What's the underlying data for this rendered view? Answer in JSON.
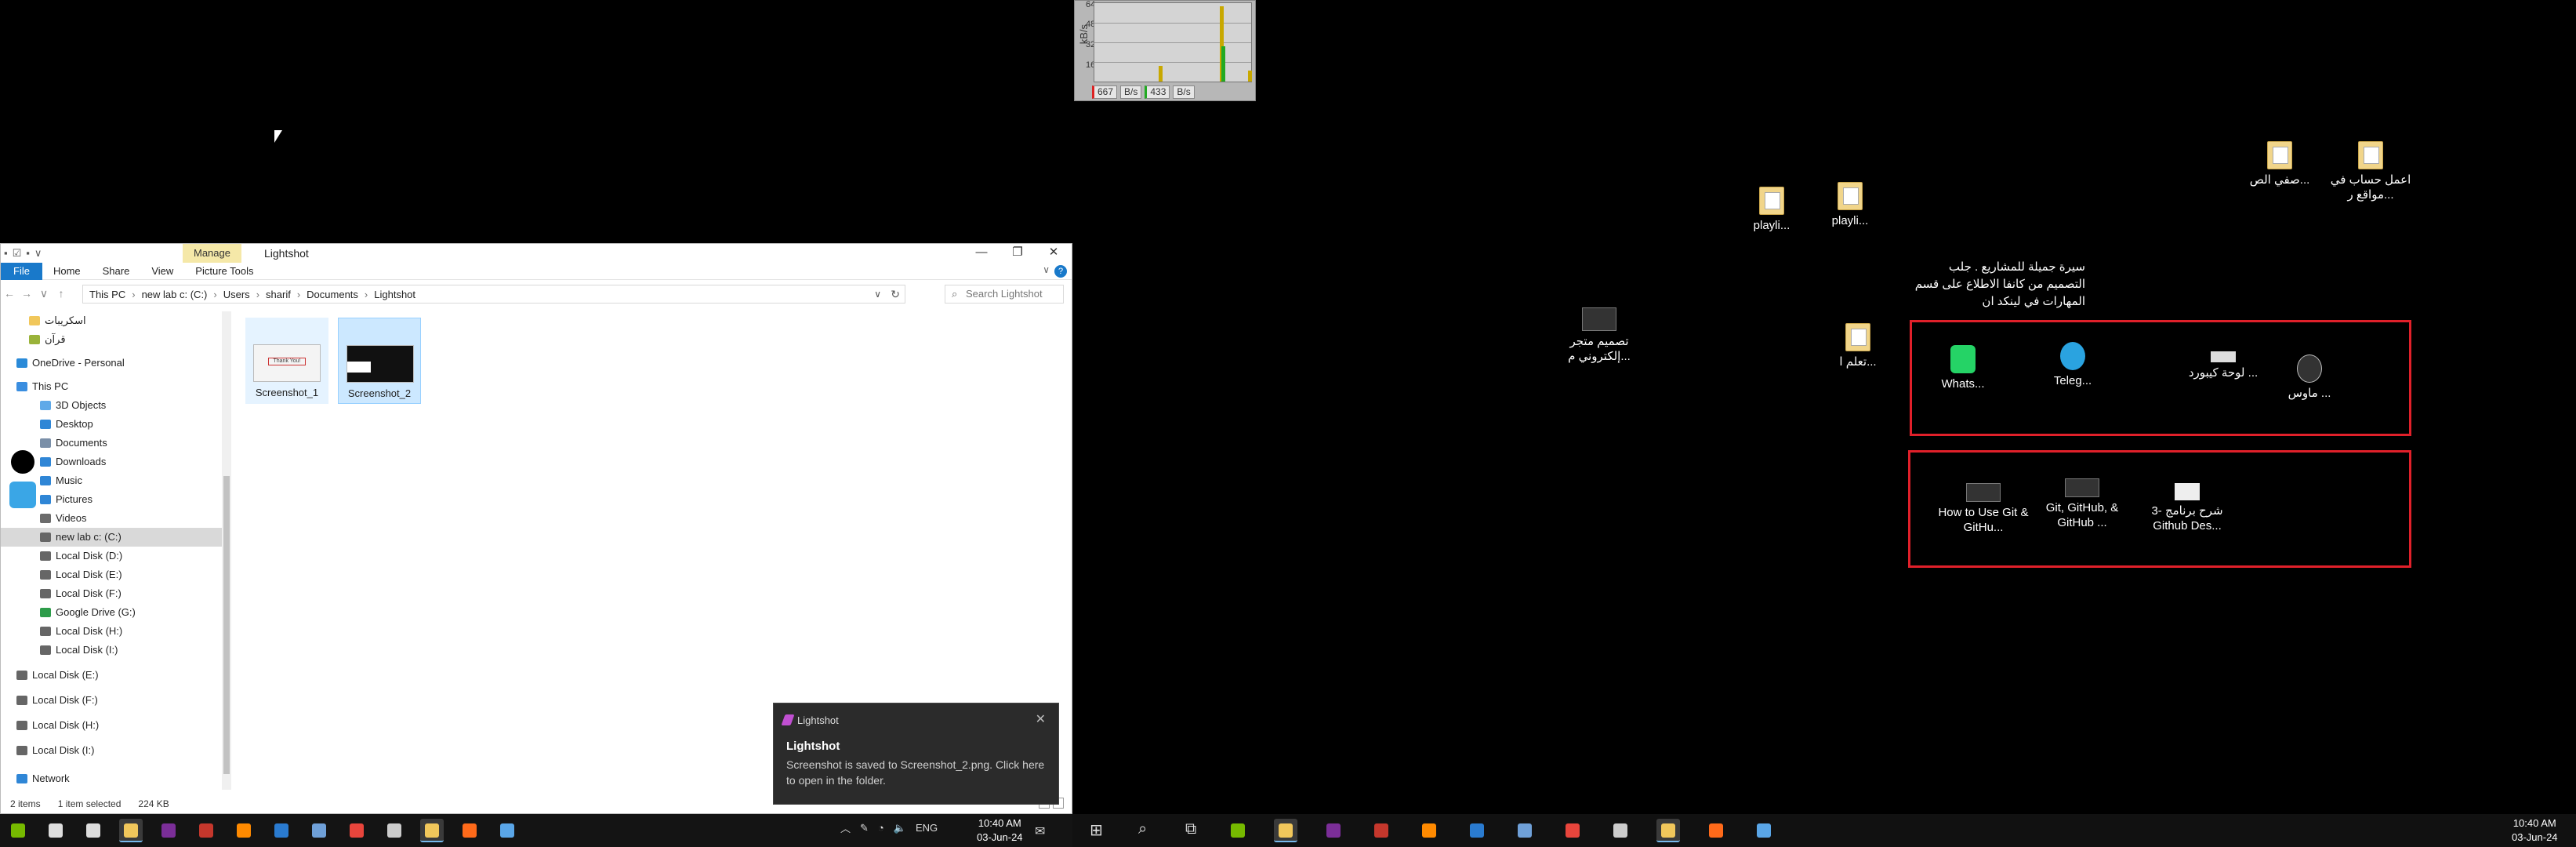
{
  "netmeter": {
    "unit": "kB/s",
    "ticks": [
      "64",
      "48",
      "32",
      "16"
    ],
    "download_value": "667",
    "download_unit": "B/s",
    "upload_value": "433",
    "upload_unit": "B/s",
    "colors": {
      "download": "#d22222",
      "upload": "#22aa22",
      "accent": "#c8a800"
    }
  },
  "desktop": {
    "icons": [
      {
        "id": "d1",
        "label": "اعمل حساب في مواقع ر...",
        "icon": "folder-file-icon"
      },
      {
        "id": "d2",
        "label": "صفي الص...",
        "icon": "folder-file-icon"
      },
      {
        "id": "d3",
        "label": "playli...",
        "icon": "file-icon"
      },
      {
        "id": "d4",
        "label": "playli...",
        "icon": "file-icon"
      },
      {
        "id": "d5",
        "label": "تصميم متجر إلكتروني م...",
        "icon": "image-thumbnail-icon"
      },
      {
        "id": "d6",
        "label": "تعلم ا...",
        "icon": "file-icon"
      },
      {
        "id": "d7",
        "label": "Whats...",
        "icon": "whatsapp-icon"
      },
      {
        "id": "d8",
        "label": "Teleg...",
        "icon": "telegram-icon"
      },
      {
        "id": "d9",
        "label": "لوحة كيبورد ...",
        "icon": "keyboard-icon"
      },
      {
        "id": "d10",
        "label": "ماوس ...",
        "icon": "mouse-icon"
      },
      {
        "id": "d11",
        "label": "How to Use Git & GitHu...",
        "icon": "video-thumbnail-icon"
      },
      {
        "id": "d12",
        "label": "Git, GitHub, & GitHub ...",
        "icon": "video-thumbnail-icon"
      },
      {
        "id": "d13",
        "label": "3- شرح برنامج Github Des...",
        "icon": "video-thumbnail-icon"
      }
    ],
    "note": "سيرة جميلة للمشاريع . جلب التصميم من كانفا الاطلاع على قسم المهارات في لينكد ان"
  },
  "explorer": {
    "qat": [
      "▪",
      "☑",
      "▪",
      "∨"
    ],
    "manage_tab": "Manage",
    "title": "Lightshot",
    "window_controls": [
      "—",
      "❐",
      "✕"
    ],
    "ribbon_tabs": [
      "File",
      "Home",
      "Share",
      "View",
      "Picture Tools"
    ],
    "help": "?",
    "chevron": "∨",
    "nav_buttons": [
      "←",
      "→",
      "∨",
      "↑"
    ],
    "breadcrumb": [
      "This PC",
      "new lab c: (C:)",
      "Users",
      "sharif",
      "Documents",
      "Lightshot"
    ],
    "breadcrumb_sep": "›",
    "address_dropdown": "∨",
    "refresh": "↻",
    "search_placeholder": "Search Lightshot",
    "search_glyph": "⌕",
    "nav_items": [
      {
        "label": "اسكريبات",
        "icon": "folder-icon",
        "color": "#f1c75b"
      },
      {
        "label": "قرآن",
        "icon": "folder-icon",
        "color": "#9ab33a"
      },
      {
        "label": "OneDrive - Personal",
        "icon": "onedrive-icon",
        "color": "#2a8ad8"
      },
      {
        "label": "This PC",
        "icon": "pc-icon",
        "color": "#3a8ee0"
      },
      {
        "label": "3D Objects",
        "icon": "3d-objects-icon",
        "color": "#5fa9e8"
      },
      {
        "label": "Desktop",
        "icon": "desktop-folder-icon",
        "color": "#2f86d6"
      },
      {
        "label": "Documents",
        "icon": "documents-icon",
        "color": "#7a8fa8"
      },
      {
        "label": "Downloads",
        "icon": "downloads-icon",
        "color": "#2f86d6"
      },
      {
        "label": "Music",
        "icon": "music-icon",
        "color": "#2f86d6"
      },
      {
        "label": "Pictures",
        "icon": "pictures-icon",
        "color": "#2f86d6"
      },
      {
        "label": "Videos",
        "icon": "videos-icon",
        "color": "#6b6b6b"
      },
      {
        "label": "new lab c: (C:)",
        "icon": "drive-icon",
        "color": "#666666"
      },
      {
        "label": "Local Disk (D:)",
        "icon": "drive-icon",
        "color": "#666666"
      },
      {
        "label": "Local Disk (E:)",
        "icon": "drive-icon",
        "color": "#666666"
      },
      {
        "label": "Local Disk (F:)",
        "icon": "drive-icon",
        "color": "#666666"
      },
      {
        "label": "Google Drive (G:)",
        "icon": "google-drive-icon",
        "color": "#2d9c4a"
      },
      {
        "label": "Local Disk (H:)",
        "icon": "drive-icon",
        "color": "#666666"
      },
      {
        "label": "Local Disk (I:)",
        "icon": "drive-icon",
        "color": "#666666"
      },
      {
        "label": "Local Disk (E:)",
        "icon": "drive-icon",
        "color": "#666666"
      },
      {
        "label": "Local Disk (F:)",
        "icon": "drive-icon",
        "color": "#666666"
      },
      {
        "label": "Local Disk (H:)",
        "icon": "drive-icon",
        "color": "#666666"
      },
      {
        "label": "Local Disk (I:)",
        "icon": "drive-icon",
        "color": "#666666"
      },
      {
        "label": "Network",
        "icon": "network-icon",
        "color": "#2f86d6"
      }
    ],
    "selected_nav": "new lab c: (C:)",
    "files": [
      {
        "name": "Screenshot_1",
        "state": "hover",
        "thumb_label": "Thank You!"
      },
      {
        "name": "Screenshot_2",
        "state": "selected"
      }
    ],
    "status": {
      "items": "2 items",
      "selection": "1 item selected",
      "size": "224 KB"
    }
  },
  "toast": {
    "app_name": "Lightshot",
    "close": "✕",
    "title": "Lightshot",
    "body": "Screenshot is saved to Screenshot_2.png. Click here to open in the folder."
  },
  "taskbar_left": {
    "tray_chevron": "︿",
    "lang": "ENG",
    "time": "10:40 AM",
    "date": "03-Jun-24",
    "notify_glyph": "✉",
    "apps": [
      {
        "name": "nvidia-icon",
        "color": "#76b900"
      },
      {
        "name": "search-icon",
        "color": "#dddddd"
      },
      {
        "name": "task-view-icon",
        "color": "#dddddd"
      },
      {
        "name": "file-explorer-icon",
        "color": "#f1c75b",
        "active": true
      },
      {
        "name": "onenote-icon",
        "color": "#7b2e98"
      },
      {
        "name": "app-red-icon",
        "color": "#c5372c"
      },
      {
        "name": "search-everything-icon",
        "color": "#ff8a00"
      },
      {
        "name": "clock-app-icon",
        "color": "#2a7bd0"
      },
      {
        "name": "notepad-icon",
        "color": "#6fa0d8"
      },
      {
        "name": "chrome-icon",
        "color": "#e8453c"
      },
      {
        "name": "terminal-icon",
        "color": "#cccccc"
      },
      {
        "name": "lightshot-folder-icon",
        "color": "#f1c75b",
        "active": true
      },
      {
        "name": "firefox-icon",
        "color": "#ff6a1a"
      },
      {
        "name": "photos-icon",
        "color": "#5aa6e8"
      }
    ]
  },
  "taskbar_right": {
    "time": "10:40 AM",
    "date": "03-Jun-24",
    "start_glyph": "⊞",
    "search_glyph": "⌕",
    "taskview_glyph": "⧉",
    "apps": [
      {
        "name": "nvidia-icon",
        "color": "#76b900"
      },
      {
        "name": "file-explorer-icon",
        "color": "#f1c75b",
        "active": true
      },
      {
        "name": "onenote-icon",
        "color": "#7b2e98"
      },
      {
        "name": "app-red-icon",
        "color": "#c5372c"
      },
      {
        "name": "search-everything-icon",
        "color": "#ff8a00"
      },
      {
        "name": "clock-app-icon",
        "color": "#2a7bd0"
      },
      {
        "name": "notepad-icon",
        "color": "#6fa0d8"
      },
      {
        "name": "chrome-icon",
        "color": "#e8453c"
      },
      {
        "name": "terminal-icon",
        "color": "#cccccc"
      },
      {
        "name": "lightshot-folder-icon",
        "color": "#f1c75b",
        "active": true
      },
      {
        "name": "firefox-icon",
        "color": "#ff6a1a"
      },
      {
        "name": "photos-icon",
        "color": "#5aa6e8"
      }
    ]
  }
}
